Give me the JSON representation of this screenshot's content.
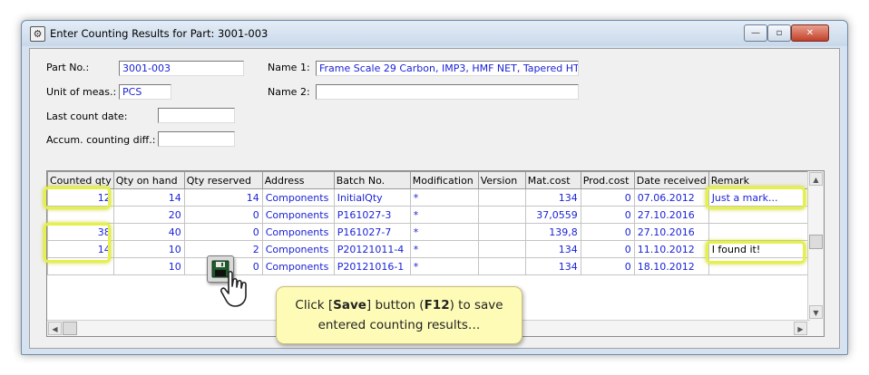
{
  "window": {
    "title": "Enter Counting Results for Part: 3001-003",
    "controls": {
      "minimize": "—",
      "maximize": "▫",
      "close": "✕"
    }
  },
  "form": {
    "part_no_label": "Part No.:",
    "part_no_value": "3001-003",
    "unit_label": "Unit of meas.:",
    "unit_value": "PCS",
    "last_count_label": "Last count date:",
    "last_count_value": "",
    "accum_label": "Accum. counting diff.:",
    "accum_value": "",
    "name1_label": "Name 1:",
    "name1_value": "Frame Scale 29 Carbon, IMP3, HMF NET, Tapered HT",
    "name2_label": "Name 2:",
    "name2_value": ""
  },
  "grid": {
    "columns": [
      "Counted qty",
      "Qty on hand",
      "Qty reserved",
      "Address",
      "Batch No.",
      "Modification",
      "Version",
      "Mat.cost",
      "Prod.cost",
      "Date received",
      "Remark"
    ],
    "rows": [
      {
        "counted": "12",
        "on_hand": "14",
        "reserved": "14",
        "address": "Components",
        "batch": "InitialQty",
        "modification": "*",
        "version": "",
        "mat_cost": "134",
        "prod_cost": "0",
        "date": "07.06.2012",
        "remark": "Just a mark..."
      },
      {
        "counted": "",
        "on_hand": "20",
        "reserved": "0",
        "address": "Components",
        "batch": "P161027-3",
        "modification": "*",
        "version": "",
        "mat_cost": "37,0559",
        "prod_cost": "0",
        "date": "27.10.2016",
        "remark": ""
      },
      {
        "counted": "38",
        "on_hand": "40",
        "reserved": "0",
        "address": "Components",
        "batch": "P161027-7",
        "modification": "*",
        "version": "",
        "mat_cost": "139,8",
        "prod_cost": "0",
        "date": "27.10.2016",
        "remark": ""
      },
      {
        "counted": "14",
        "on_hand": "10",
        "reserved": "2",
        "address": "Components",
        "batch": "P20121011-4",
        "modification": "*",
        "version": "",
        "mat_cost": "134",
        "prod_cost": "0",
        "date": "11.10.2012",
        "remark": "I found it!"
      },
      {
        "counted": "",
        "on_hand": "10",
        "reserved": "0",
        "address": "Components",
        "batch": "P20121016-1",
        "modification": "*",
        "version": "",
        "mat_cost": "134",
        "prod_cost": "0",
        "date": "18.10.2012",
        "remark": ""
      }
    ]
  },
  "icons": {
    "app": "settings-gear-icon",
    "save": "floppy-disk-icon",
    "pointer": "hand-pointer-icon"
  },
  "callout": {
    "text_before": "Click [",
    "save_word": "Save",
    "text_mid": "] button (",
    "key": "F12",
    "text_after": ") to save entered counting results…"
  },
  "colors": {
    "value_text": "#1a23d6",
    "remark_text": "#137a13",
    "highlight": "#e5f04a",
    "callout_bg": "#fdfbb6"
  }
}
